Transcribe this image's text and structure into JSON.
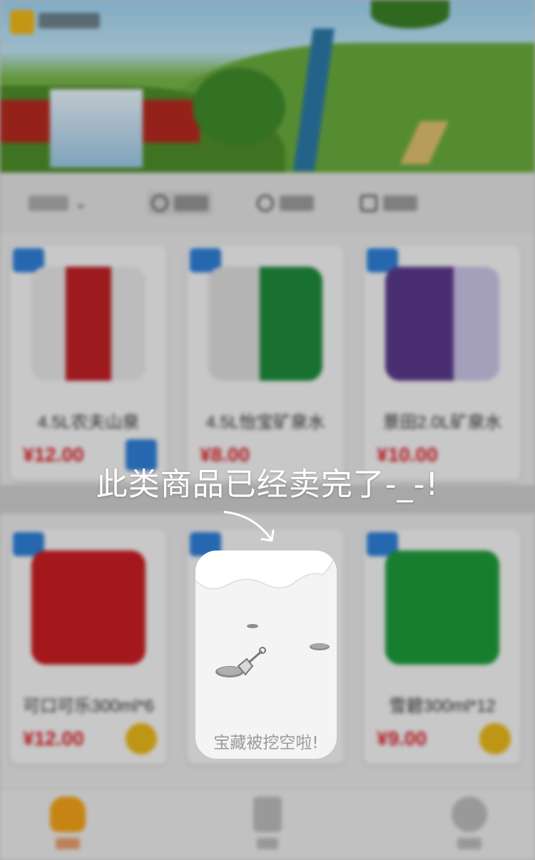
{
  "overlay": {
    "message": "此类商品已经卖完了-_-!",
    "empty_card_text": "宝藏被挖空啦!"
  },
  "colors": {
    "accent": "#f2a21a",
    "price": "#d9202a",
    "badge": "#2f7fd6",
    "overlay_text": "#ffffff"
  },
  "products": [
    {
      "name": "4.5L农夫山泉",
      "price": "¥12.00"
    },
    {
      "name": "4.5L怡宝矿泉水",
      "price": "¥8.00"
    },
    {
      "name": "景田2.0L矿泉水",
      "price": "¥10.00"
    },
    {
      "name": "可口可乐300ml*6",
      "price": "¥12.00"
    },
    {
      "name": "",
      "price": ""
    },
    {
      "name": "雪碧300ml*12",
      "price": "¥9.00"
    }
  ],
  "icons": [
    "home-icon",
    "order-icon",
    "profile-icon",
    "shovel-icon",
    "arrow-icon"
  ]
}
